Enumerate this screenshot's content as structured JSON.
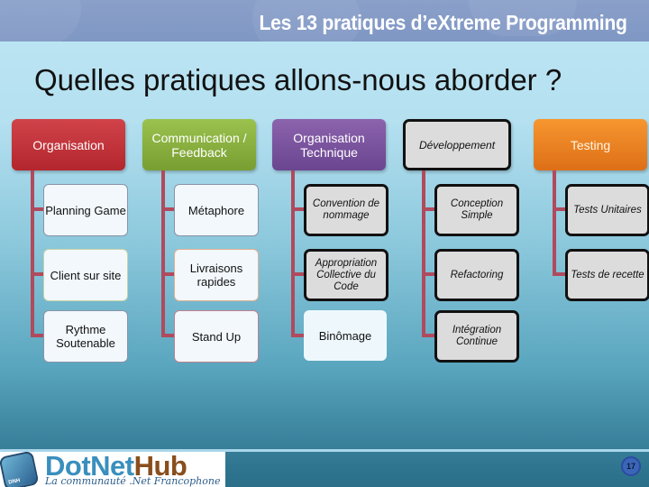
{
  "header": {
    "title": "Les 13 pratiques d’eXtreme Programming"
  },
  "slide": {
    "title": "Quelles pratiques allons-nous aborder ?"
  },
  "columns": [
    {
      "label": "Organisation",
      "color": "#c0343b",
      "items": [
        "Planning Game",
        "Client sur site",
        "Rythme Soutenable"
      ]
    },
    {
      "label": "Communication / Feedback",
      "color": "#8ab040",
      "items": [
        "Métaphore",
        "Livraisons rapides",
        "Stand Up"
      ]
    },
    {
      "label": "Organisation Technique",
      "color": "#7b549f",
      "items": [
        "Convention de nommage",
        "Appropriation Collective du Code",
        "Binômage"
      ]
    },
    {
      "label": "Développement",
      "color": "#dcdcdc",
      "items": [
        "Conception Simple",
        "Refactoring",
        "Intégration Continue"
      ]
    },
    {
      "label": "Testing",
      "color": "#f08223",
      "items": [
        "Tests Unitaires",
        "Tests de recette"
      ]
    }
  ],
  "footer": {
    "logo_brand_part1": "DotNet",
    "logo_brand_part2": "Hub",
    "logo_tagline": "La communauté .Net Francophone",
    "logo_badge_text": "DNH",
    "page_number": "17"
  }
}
